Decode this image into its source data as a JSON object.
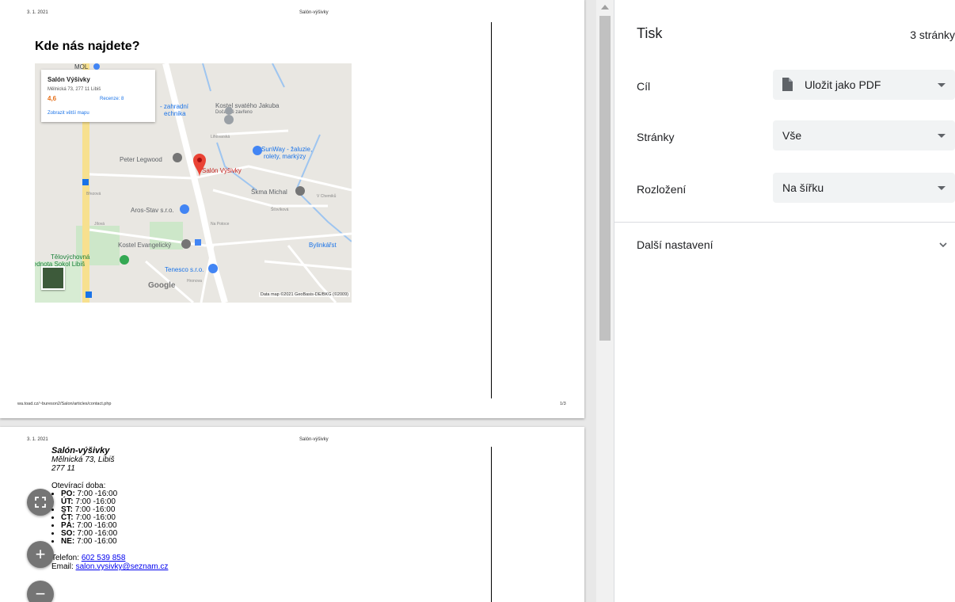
{
  "preview": {
    "page1": {
      "header_date": "3. 1. 2021",
      "header_title": "Salón-výšivky",
      "heading": "Kde nás najdete?",
      "footer_url": "wa.toad.cz/~bureson2/Salon/articles/contact.php",
      "footer_page": "1/3",
      "map": {
        "card_name": "Salón Výšivky",
        "card_address": "Mělnická 73, 277 11 Libiš",
        "card_rating": "4,6",
        "card_reviews": "Recenze: 8",
        "card_link": "Zobrazit větší mapu",
        "label_mol": "MOL",
        "label_zahradni": "- zahradní",
        "label_technika": "echnika",
        "label_kostel_jakuba": "Kostel svatého Jakuba",
        "label_docasne": "Dočasně zavřeno",
        "label_sunway_1": "SunWay - žaluzie,",
        "label_sunway_2": "rolety, markýzy",
        "label_peter": "Peter Legwood",
        "label_salon": "Salón Výšivky",
        "label_skrna": "Škma Michal",
        "label_aros": "Aros-Stav s.r.o.",
        "label_kostel_ev": "Kostel Evangelický",
        "label_bylinkarst": "Bylinkářst",
        "label_telo1": "Tělovýchovná",
        "label_telo2": "jednota Sokol Libiš",
        "label_tenesco": "Tenesco s.r.o.",
        "label_google": "Google",
        "attribution": "Data map ©2021 GeoBasis-DE/BKG (©2009)",
        "street_brizova": "Březová",
        "street_jiloven": "Jílová",
        "street_napotoce": "Na Potoce",
        "street_lihovarska": "Lihovarská",
        "street_chemiku": "V Chemiků",
        "street_spochova": "Šťovíková",
        "street_hronova": "Hronova"
      }
    },
    "page2": {
      "header_date": "3. 1. 2021",
      "header_title": "Salón-výšivky",
      "company": "Salón-výšivky",
      "street": "Mělnická 73, Libiš",
      "zip": "277 11",
      "hours_title": "Otevírací doba:",
      "hours": [
        {
          "day": "PO:",
          "time": " 7:00 -16:00"
        },
        {
          "day": "ÚT:",
          "time": " 7:00 -16:00"
        },
        {
          "day": "ST:",
          "time": " 7:00 -16:00"
        },
        {
          "day": "ČT:",
          "time": " 7:00 -16:00"
        },
        {
          "day": "PÁ:",
          "time": " 7:00 -16:00"
        },
        {
          "day": "SO:",
          "time": " 7:00 -16:00"
        },
        {
          "day": "NE:",
          "time": " 7:00 -16:00"
        }
      ],
      "phone_label": "Telefon: ",
      "phone": "602 539 858",
      "email_label": "Email: ",
      "email": "salon.vysivky@seznam.cz"
    },
    "zoom_buttons": {
      "fit": "fit-to-page",
      "plus": "+",
      "minus": "−"
    }
  },
  "panel": {
    "title": "Tisk",
    "page_count": "3 stránky",
    "destination_label": "Cíl",
    "destination_value": "Uložit jako PDF",
    "pages_label": "Stránky",
    "pages_value": "Vše",
    "layout_label": "Rozložení",
    "layout_value": "Na šířku",
    "more_settings": "Další nastavení"
  },
  "colors": {
    "accent": "#1a73e8",
    "pin": "#ea4335",
    "select_bg": "#f1f3f4"
  }
}
